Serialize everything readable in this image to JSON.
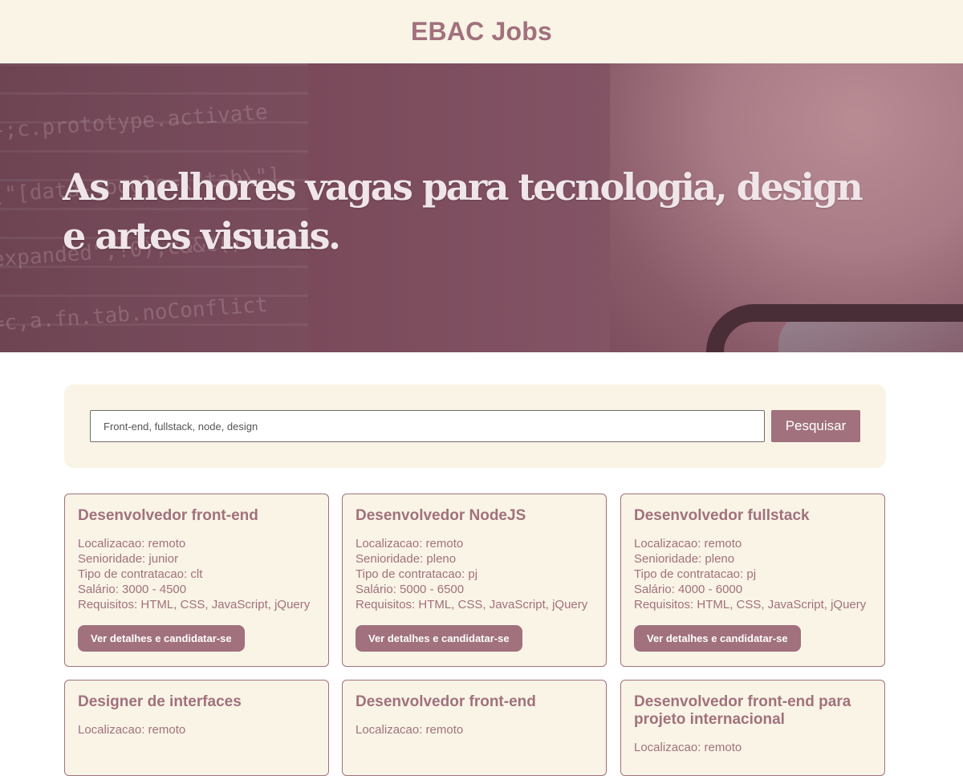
{
  "header": {
    "title": "EBAC Jobs"
  },
  "hero": {
    "headline": "As melhores vagas para tecnologia, design e artes visuais."
  },
  "search": {
    "placeholder": "Front-end, fullstack, node, design",
    "button_label": "Pesquisar"
  },
  "jobs": [
    {
      "title": "Desenvolvedor front-end",
      "localizacao": "Localizacao: remoto",
      "senioridade": "Senioridade: junior",
      "contratacao": "Tipo de contratacao: clt",
      "salario": "Salário: 3000 - 4500",
      "requisitos": "Requisitos: HTML, CSS, JavaScript, jQuery",
      "button": "Ver detalhes e candidatar-se"
    },
    {
      "title": "Desenvolvedor NodeJS",
      "localizacao": "Localizacao: remoto",
      "senioridade": "Senioridade: pleno",
      "contratacao": "Tipo de contratacao: pj",
      "salario": "Salário: 5000 - 6500",
      "requisitos": "Requisitos: HTML, CSS, JavaScript, jQuery",
      "button": "Ver detalhes e candidatar-se"
    },
    {
      "title": "Desenvolvedor fullstack",
      "localizacao": "Localizacao: remoto",
      "senioridade": "Senioridade: pleno",
      "contratacao": "Tipo de contratacao: pj",
      "salario": "Salário: 4000 - 6000",
      "requisitos": "Requisitos: HTML, CSS, JavaScript, jQuery",
      "button": "Ver detalhes e candidatar-se"
    },
    {
      "title": "Designer de interfaces",
      "localizacao": "Localizacao: remoto"
    },
    {
      "title": "Desenvolvedor front-end",
      "localizacao": "Localizacao: remoto"
    },
    {
      "title": "Desenvolvedor front-end para projeto internacional",
      "localizacao": "Localizacao: remoto"
    }
  ],
  "colors": {
    "accent": "#a1717d",
    "cream": "#f9f4e6",
    "hero_tint": "#7d4e5d"
  }
}
